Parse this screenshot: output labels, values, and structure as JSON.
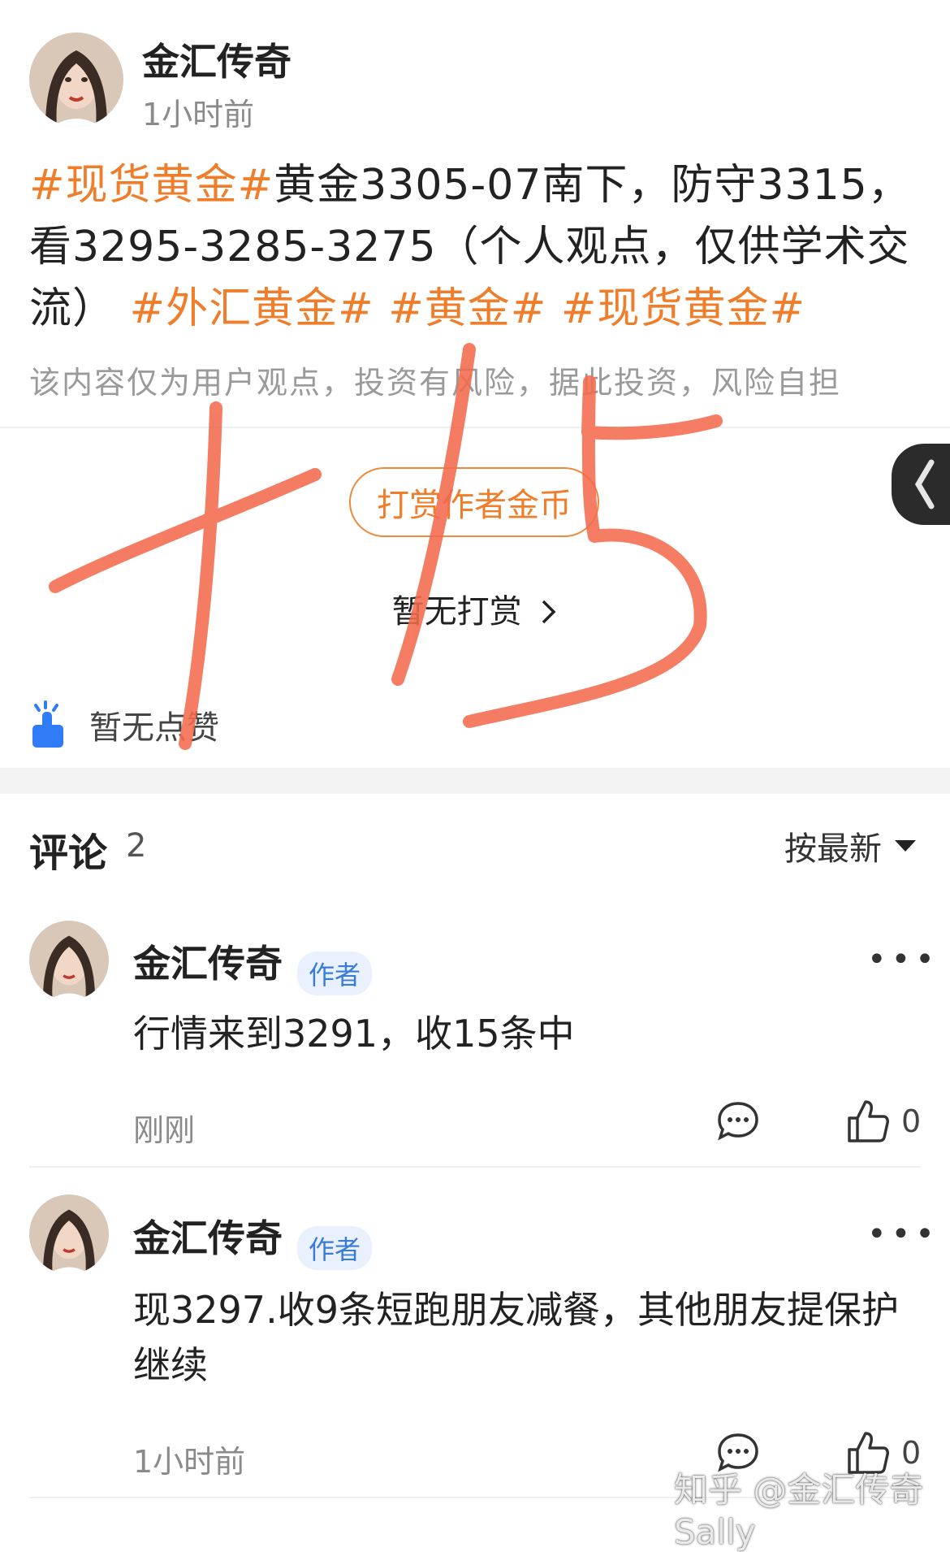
{
  "post": {
    "author": "金汇传奇",
    "time": "1小时前",
    "tag1": "#现货黄金#",
    "body_text": "黄金3305-07南下，防守3315，看3295-3285-3275（个人观点，仅供学术交流）",
    "tag2": "#外汇黄金#",
    "tag3": "#黄金#",
    "tag4": "#现货黄金#",
    "disclaimer": "该内容仅为用户观点，投资有风险，据此投资，风险自担"
  },
  "reward": {
    "button_label": "打赏作者金币",
    "status": "暂无打赏",
    "chevron": "chevron-right-icon"
  },
  "likes": {
    "text": "暂无点赞",
    "icon": "hand-like-icon"
  },
  "comments": {
    "title": "评论",
    "count": "2",
    "sort_label": "按最新",
    "items": [
      {
        "author": "金汇传奇",
        "badge": "作者",
        "text": "行情来到3291，收15条中",
        "time": "刚刚",
        "likes": "0"
      },
      {
        "author": "金汇传奇",
        "badge": "作者",
        "text": "现3297.收9条短跑朋友减餐，其他朋友提保护继续",
        "time": "1小时前",
        "likes": "0"
      }
    ]
  },
  "annotation": {
    "text": "+15",
    "color": "#f26b4e"
  },
  "watermark": "知乎 @金汇传奇Sally",
  "colors": {
    "accent": "#ef7d2a",
    "badge_blue": "#3b7bd8",
    "like_blue": "#2f7cf6"
  }
}
